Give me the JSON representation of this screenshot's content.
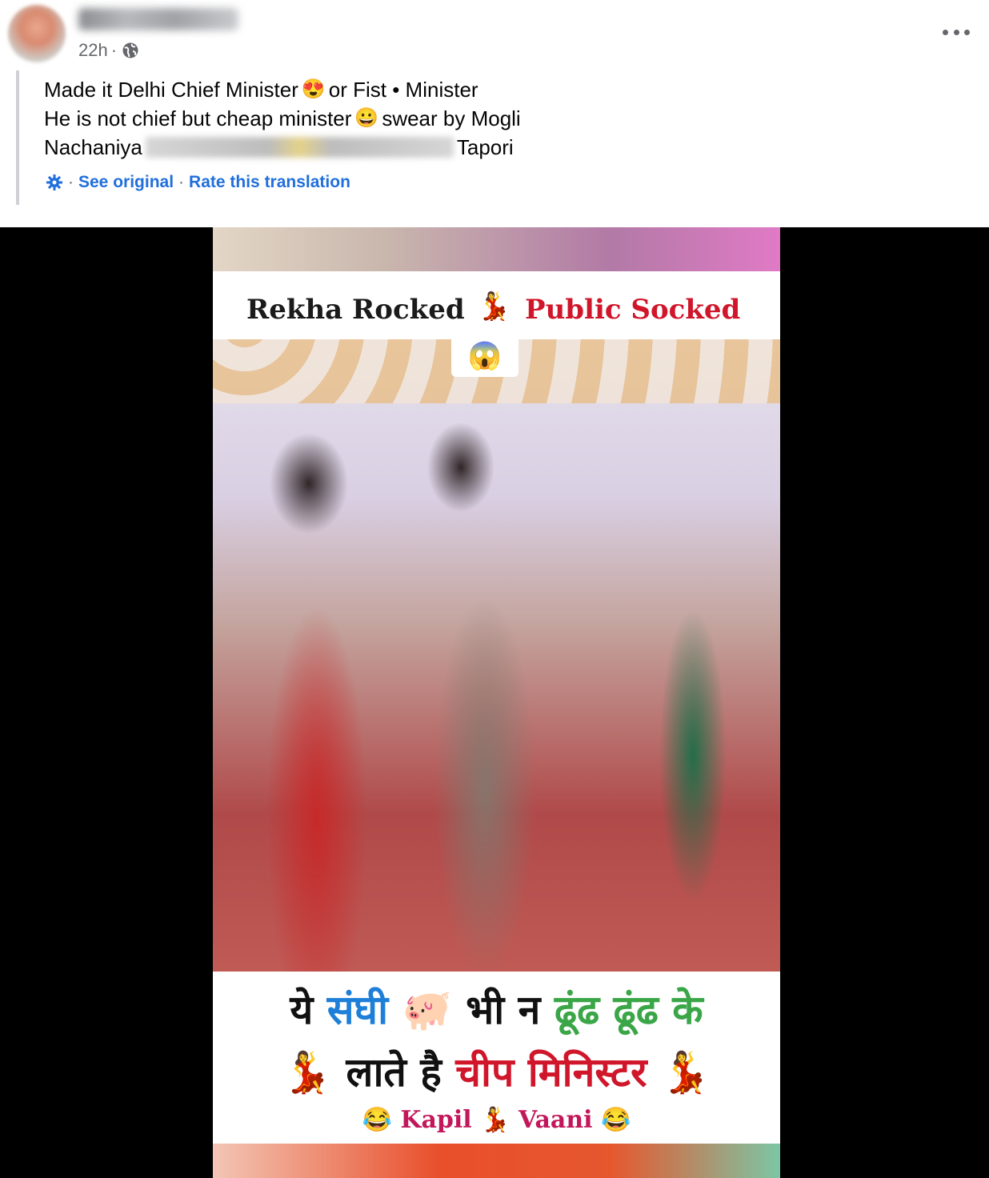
{
  "author": {
    "name": ""
  },
  "meta": {
    "time": "22h",
    "separator": "·",
    "privacy_icon": "globe-icon"
  },
  "more_icon": "more-horizontal-icon",
  "translation": {
    "line1_a": "Made it Delhi Chief Minister",
    "line1_emoji": "😍",
    "line1_b": "or Fist • Minister",
    "line2_a": "He is not chief but cheap minister",
    "line2_emoji": "😀",
    "line2_b": "swear by Mogli",
    "line3_a": "Nachaniya",
    "line3_b": "Tapori",
    "links": {
      "icon": "gear-icon",
      "sep": "·",
      "see_original": "See original",
      "rate": "Rate this translation"
    }
  },
  "video": {
    "title_left": "Rekha Rocked",
    "dancer_emoji": "💃",
    "title_right": "Public Socked",
    "shock_emoji": "😱",
    "hindi_line1": {
      "w1": "ये",
      "w2": "संघी",
      "pig": "🐖",
      "w3": "भी न",
      "w4": "ढूंढ ढूंढ के"
    },
    "hindi_line2": {
      "dancer": "💃",
      "w1": "लाते है",
      "w2": "चीप मिनिस्टर"
    },
    "credit": {
      "laugh": "😂",
      "w1": "Kapil",
      "dancer": "💃",
      "w2": "Vaani"
    }
  },
  "colors": {
    "link": "#216fdb",
    "accent_red": "#d0162a",
    "hindi_blue": "#1d7fd8",
    "hindi_green": "#3aa647"
  }
}
